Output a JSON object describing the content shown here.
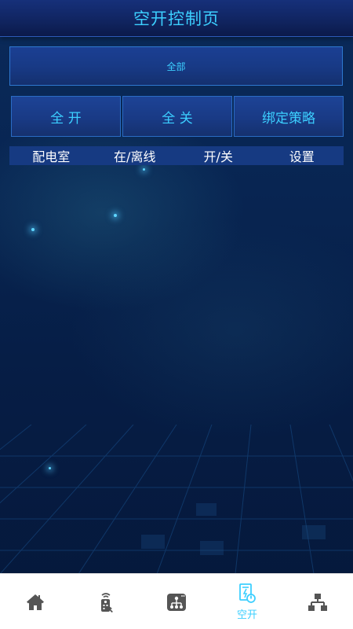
{
  "header": {
    "title": "空开控制页"
  },
  "selector": {
    "selected": "全部"
  },
  "actions": {
    "all_on": "全 开",
    "all_off": "全 关",
    "bind_strategy": "绑定策略"
  },
  "table": {
    "columns": [
      "配电室",
      "在/离线",
      "开/关",
      "设置"
    ]
  },
  "bottom_nav": {
    "items": [
      {
        "icon": "home-icon",
        "label": ""
      },
      {
        "icon": "remote-control-icon",
        "label": ""
      },
      {
        "icon": "network-device-icon",
        "label": ""
      },
      {
        "icon": "breaker-switch-icon",
        "label": "空开",
        "active": true
      },
      {
        "icon": "topology-icon",
        "label": ""
      }
    ]
  },
  "colors": {
    "accent": "#3ccfff",
    "header_bg": "#10245f",
    "nav_icon": "#555555"
  }
}
